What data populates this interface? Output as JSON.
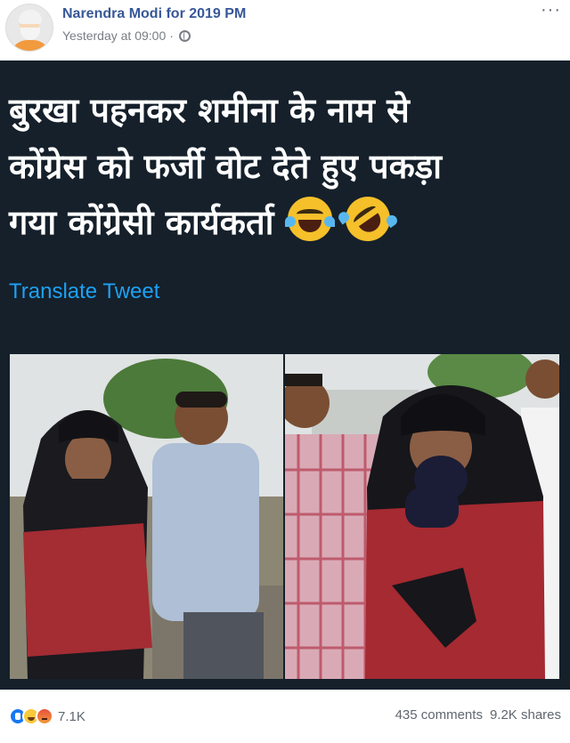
{
  "header": {
    "page_name": "Narendra Modi for 2019 PM",
    "timestamp": "Yesterday at 09:00",
    "separator": "·",
    "privacy_icon": "globe-icon",
    "more_label": "···"
  },
  "tweet": {
    "text_lines": [
      "बुरखा पहनकर शमीना के नाम से",
      "कोंग्रेस को फर्जी वोट देते हुए पकड़ा",
      "गया कोंग्रेसी कार्यकर्ता"
    ],
    "emojis": [
      "tears-of-joy-emoji",
      "rolling-on-floor-laughing-emoji"
    ],
    "translate_label": "Translate Tweet",
    "colors": {
      "background": "#15202b",
      "text": "#ffffff",
      "link": "#1da1f2"
    }
  },
  "photos": [
    {
      "name": "photo-burqa-man-left",
      "description_icon": "photo"
    },
    {
      "name": "photo-burqa-man-right",
      "description_icon": "photo"
    }
  ],
  "footer": {
    "reaction_icons": [
      "like-icon",
      "haha-icon",
      "angry-icon"
    ],
    "reaction_count": "7.1K",
    "comments": "435 comments",
    "shares": "9.2K shares"
  },
  "colors": {
    "page_name": "#385898",
    "meta": "#7a7d83"
  }
}
